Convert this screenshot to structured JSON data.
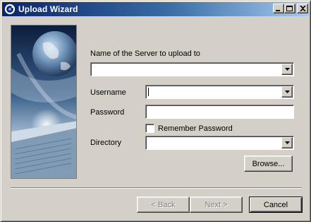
{
  "window": {
    "title": "Upload Wizard",
    "icon": "app-refresh-icon"
  },
  "title_buttons": {
    "minimize": "minimize-icon",
    "maximize": "maximize-icon",
    "close": "close-icon"
  },
  "form": {
    "server_label": "Name of the Server to upload to",
    "server_value": "",
    "username_label": "Username",
    "username_value": "",
    "password_label": "Password",
    "password_value": "",
    "remember_label": "Remember Password",
    "remember_checked": false,
    "directory_label": "Directory",
    "directory_value": "",
    "browse_label": "Browse..."
  },
  "footer": {
    "back_label": "< Back",
    "next_label": "Next >",
    "cancel_label": "Cancel"
  },
  "colors": {
    "face": "#d4d0c8",
    "title_start": "#0a246a",
    "title_end": "#a6caf0",
    "disabled_text": "#808080"
  }
}
